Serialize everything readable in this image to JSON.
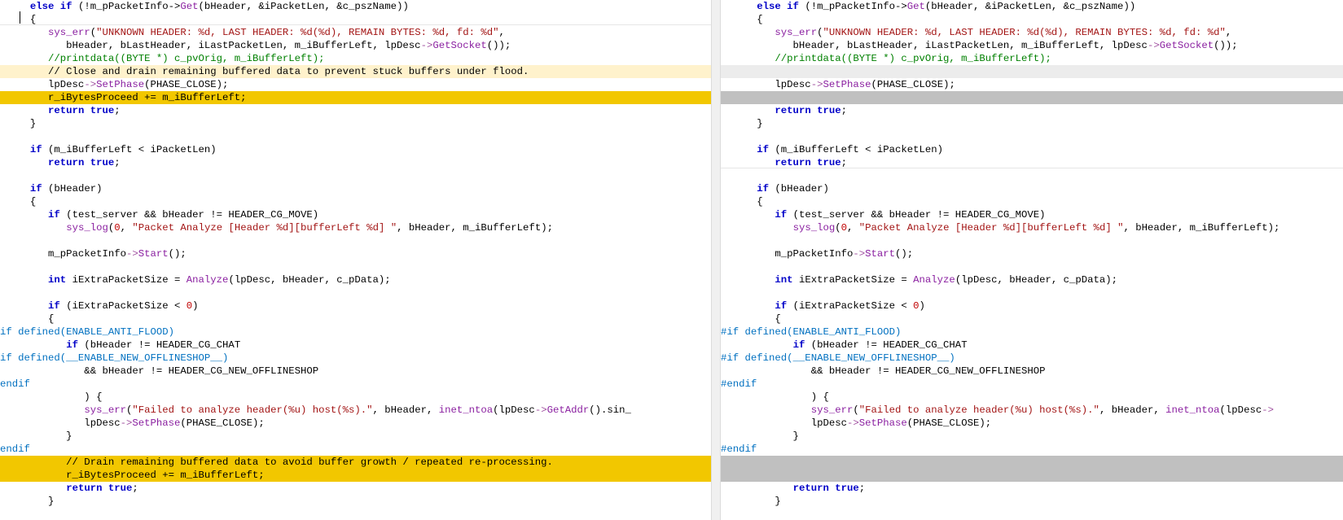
{
  "left": {
    "lines": [
      {
        "cls": "",
        "parts": [
          [
            "     ",
            ""
          ],
          [
            "else if",
            "kw"
          ],
          [
            " (!m_pPacketInfo",
            ""
          ],
          [
            "->",
            ""
          ],
          [
            "Get",
            "fn"
          ],
          [
            "(bHeader, &iPacketLen, &c_pszName))",
            ""
          ]
        ]
      },
      {
        "cls": "",
        "parts": [
          [
            "     {",
            ""
          ]
        ]
      },
      {
        "cls": "",
        "parts": [
          [
            "        ",
            ""
          ],
          [
            "sys_err",
            "fn"
          ],
          [
            "(",
            ""
          ],
          [
            "\"UNKNOWN HEADER: %d, LAST HEADER: %d(%d), REMAIN BYTES: %d, fd: %d\"",
            "str"
          ],
          [
            ",",
            ""
          ]
        ]
      },
      {
        "cls": "",
        "parts": [
          [
            "           bHeader, bLastHeader, iLastPacketLen, m_iBufferLeft, lpDesc",
            ""
          ],
          [
            "->",
            "op"
          ],
          [
            "GetSocket",
            "fn"
          ],
          [
            "());",
            ""
          ]
        ]
      },
      {
        "cls": "",
        "parts": [
          [
            "        ",
            ""
          ],
          [
            "//printdata((BYTE *) c_pvOrig, m_iBufferLeft);",
            "cm"
          ]
        ]
      },
      {
        "cls": "changed",
        "parts": [
          [
            "        // Close and drain remaining buffered data to prevent stuck buffers under flood.",
            ""
          ]
        ]
      },
      {
        "cls": "",
        "parts": [
          [
            "        lpDesc",
            ""
          ],
          [
            "->",
            "op"
          ],
          [
            "SetPhase",
            "fn"
          ],
          [
            "(PHASE_CLOSE);",
            ""
          ]
        ]
      },
      {
        "cls": "changed-strong",
        "parts": [
          [
            "        r_iBytesProceed += m_iBufferLeft;",
            ""
          ]
        ]
      },
      {
        "cls": "",
        "parts": [
          [
            "        ",
            ""
          ],
          [
            "return true",
            "kw"
          ],
          [
            ";",
            ""
          ]
        ]
      },
      {
        "cls": "",
        "parts": [
          [
            "     }",
            ""
          ]
        ]
      },
      {
        "cls": "",
        "parts": [
          [
            "",
            ""
          ]
        ]
      },
      {
        "cls": "",
        "parts": [
          [
            "     ",
            ""
          ],
          [
            "if",
            "kw"
          ],
          [
            " (m_iBufferLeft < iPacketLen)",
            ""
          ]
        ]
      },
      {
        "cls": "",
        "parts": [
          [
            "        ",
            ""
          ],
          [
            "return true",
            "kw"
          ],
          [
            ";",
            ""
          ]
        ]
      },
      {
        "cls": "",
        "parts": [
          [
            "",
            ""
          ]
        ]
      },
      {
        "cls": "",
        "parts": [
          [
            "     ",
            ""
          ],
          [
            "if",
            "kw"
          ],
          [
            " (bHeader)",
            ""
          ]
        ]
      },
      {
        "cls": "",
        "parts": [
          [
            "     {",
            ""
          ]
        ]
      },
      {
        "cls": "",
        "parts": [
          [
            "        ",
            ""
          ],
          [
            "if",
            "kw"
          ],
          [
            " (test_server && bHeader != HEADER_CG_MOVE)",
            ""
          ]
        ]
      },
      {
        "cls": "",
        "parts": [
          [
            "           ",
            ""
          ],
          [
            "sys_log",
            "fn"
          ],
          [
            "(",
            ""
          ],
          [
            "0",
            "num"
          ],
          [
            ", ",
            ""
          ],
          [
            "\"Packet Analyze [Header %d][bufferLeft %d] \"",
            "str"
          ],
          [
            ", bHeader, m_iBufferLeft);",
            ""
          ]
        ]
      },
      {
        "cls": "",
        "parts": [
          [
            "",
            ""
          ]
        ]
      },
      {
        "cls": "",
        "parts": [
          [
            "        m_pPacketInfo",
            ""
          ],
          [
            "->",
            "op"
          ],
          [
            "Start",
            "fn"
          ],
          [
            "();",
            ""
          ]
        ]
      },
      {
        "cls": "",
        "parts": [
          [
            "",
            ""
          ]
        ]
      },
      {
        "cls": "",
        "parts": [
          [
            "        ",
            ""
          ],
          [
            "int",
            "kw"
          ],
          [
            " iExtraPacketSize = ",
            ""
          ],
          [
            "Analyze",
            "fn"
          ],
          [
            "(lpDesc, bHeader, c_pData);",
            ""
          ]
        ]
      },
      {
        "cls": "",
        "parts": [
          [
            "",
            ""
          ]
        ]
      },
      {
        "cls": "",
        "parts": [
          [
            "        ",
            ""
          ],
          [
            "if",
            "kw"
          ],
          [
            " (iExtraPacketSize < ",
            ""
          ],
          [
            "0",
            "num"
          ],
          [
            ")",
            ""
          ]
        ]
      },
      {
        "cls": "",
        "parts": [
          [
            "        {",
            ""
          ]
        ]
      },
      {
        "cls": "",
        "parts": [
          [
            "if defined(ENABLE_ANTI_FLOOD)",
            "pp"
          ]
        ]
      },
      {
        "cls": "",
        "parts": [
          [
            "           ",
            ""
          ],
          [
            "if",
            "kw"
          ],
          [
            " (bHeader != HEADER_CG_CHAT",
            ""
          ]
        ]
      },
      {
        "cls": "",
        "parts": [
          [
            "if defined(__ENABLE_NEW_OFFLINESHOP__)",
            "pp"
          ]
        ]
      },
      {
        "cls": "",
        "parts": [
          [
            "              && bHeader != HEADER_CG_NEW_OFFLINESHOP",
            ""
          ]
        ]
      },
      {
        "cls": "",
        "parts": [
          [
            "endif",
            "pp"
          ]
        ]
      },
      {
        "cls": "",
        "parts": [
          [
            "              ) {",
            ""
          ]
        ]
      },
      {
        "cls": "",
        "parts": [
          [
            "              ",
            ""
          ],
          [
            "sys_err",
            "fn"
          ],
          [
            "(",
            ""
          ],
          [
            "\"Failed to analyze header(%u) host(%s).\"",
            "str"
          ],
          [
            ", bHeader, ",
            ""
          ],
          [
            "inet_ntoa",
            "fn"
          ],
          [
            "(lpDesc",
            ""
          ],
          [
            "->",
            "op"
          ],
          [
            "GetAddr",
            "fn"
          ],
          [
            "().sin_",
            ""
          ]
        ]
      },
      {
        "cls": "",
        "parts": [
          [
            "              lpDesc",
            ""
          ],
          [
            "->",
            "op"
          ],
          [
            "SetPhase",
            "fn"
          ],
          [
            "(PHASE_CLOSE);",
            ""
          ]
        ]
      },
      {
        "cls": "",
        "parts": [
          [
            "           }",
            ""
          ]
        ]
      },
      {
        "cls": "",
        "parts": [
          [
            "endif",
            "pp"
          ]
        ]
      },
      {
        "cls": "changed-strong",
        "parts": [
          [
            "           // Drain remaining buffered data to avoid buffer growth / repeated re-processing.",
            ""
          ]
        ]
      },
      {
        "cls": "changed-strong",
        "parts": [
          [
            "           r_iBytesProceed += m_iBufferLeft;",
            ""
          ]
        ]
      },
      {
        "cls": "",
        "parts": [
          [
            "           ",
            ""
          ],
          [
            "return true",
            "kw"
          ],
          [
            ";",
            ""
          ]
        ]
      },
      {
        "cls": "",
        "parts": [
          [
            "        }",
            ""
          ]
        ]
      }
    ]
  },
  "right": {
    "lines": [
      {
        "cls": "",
        "parts": [
          [
            "      ",
            ""
          ],
          [
            "else if",
            "kw"
          ],
          [
            " (!m_pPacketInfo",
            ""
          ],
          [
            "->",
            ""
          ],
          [
            "Get",
            "fn"
          ],
          [
            "(bHeader, &iPacketLen, &c_pszName))",
            ""
          ]
        ]
      },
      {
        "cls": "",
        "parts": [
          [
            "      {",
            ""
          ]
        ]
      },
      {
        "cls": "",
        "parts": [
          [
            "         ",
            ""
          ],
          [
            "sys_err",
            "fn"
          ],
          [
            "(",
            ""
          ],
          [
            "\"UNKNOWN HEADER: %d, LAST HEADER: %d(%d), REMAIN BYTES: %d, fd: %d\"",
            "str"
          ],
          [
            ",",
            ""
          ]
        ]
      },
      {
        "cls": "",
        "parts": [
          [
            "            bHeader, bLastHeader, iLastPacketLen, m_iBufferLeft, lpDesc",
            ""
          ],
          [
            "->",
            "op"
          ],
          [
            "GetSocket",
            "fn"
          ],
          [
            "());",
            ""
          ]
        ]
      },
      {
        "cls": "",
        "parts": [
          [
            "         ",
            ""
          ],
          [
            "//printdata((BYTE *) c_pvOrig, m_iBufferLeft);",
            "cm"
          ]
        ]
      },
      {
        "cls": "gap",
        "parts": [
          [
            "",
            ""
          ]
        ]
      },
      {
        "cls": "",
        "parts": [
          [
            "         lpDesc",
            ""
          ],
          [
            "->",
            "op"
          ],
          [
            "SetPhase",
            "fn"
          ],
          [
            "(PHASE_CLOSE);",
            ""
          ]
        ]
      },
      {
        "cls": "gap-strong",
        "parts": [
          [
            "",
            ""
          ]
        ]
      },
      {
        "cls": "",
        "parts": [
          [
            "         ",
            ""
          ],
          [
            "return true",
            "kw"
          ],
          [
            ";",
            ""
          ]
        ]
      },
      {
        "cls": "",
        "parts": [
          [
            "      }",
            ""
          ]
        ]
      },
      {
        "cls": "",
        "parts": [
          [
            "",
            ""
          ]
        ]
      },
      {
        "cls": "",
        "parts": [
          [
            "      ",
            ""
          ],
          [
            "if",
            "kw"
          ],
          [
            " (m_iBufferLeft < iPacketLen)",
            ""
          ]
        ]
      },
      {
        "cls": "",
        "parts": [
          [
            "         ",
            ""
          ],
          [
            "return true",
            "kw"
          ],
          [
            ";",
            ""
          ]
        ]
      },
      {
        "cls": "",
        "parts": [
          [
            "",
            ""
          ]
        ]
      },
      {
        "cls": "",
        "parts": [
          [
            "      ",
            ""
          ],
          [
            "if",
            "kw"
          ],
          [
            " (bHeader)",
            ""
          ]
        ]
      },
      {
        "cls": "",
        "parts": [
          [
            "      {",
            ""
          ]
        ]
      },
      {
        "cls": "",
        "parts": [
          [
            "         ",
            ""
          ],
          [
            "if",
            "kw"
          ],
          [
            " (test_server && bHeader != HEADER_CG_MOVE)",
            ""
          ]
        ]
      },
      {
        "cls": "",
        "parts": [
          [
            "            ",
            ""
          ],
          [
            "sys_log",
            "fn"
          ],
          [
            "(",
            ""
          ],
          [
            "0",
            "num"
          ],
          [
            ", ",
            ""
          ],
          [
            "\"Packet Analyze [Header %d][bufferLeft %d] \"",
            "str"
          ],
          [
            ", bHeader, m_iBufferLeft);",
            ""
          ]
        ]
      },
      {
        "cls": "",
        "parts": [
          [
            "",
            ""
          ]
        ]
      },
      {
        "cls": "",
        "parts": [
          [
            "         m_pPacketInfo",
            ""
          ],
          [
            "->",
            "op"
          ],
          [
            "Start",
            "fn"
          ],
          [
            "();",
            ""
          ]
        ]
      },
      {
        "cls": "",
        "parts": [
          [
            "",
            ""
          ]
        ]
      },
      {
        "cls": "",
        "parts": [
          [
            "         ",
            ""
          ],
          [
            "int",
            "kw"
          ],
          [
            " iExtraPacketSize = ",
            ""
          ],
          [
            "Analyze",
            "fn"
          ],
          [
            "(lpDesc, bHeader, c_pData);",
            ""
          ]
        ]
      },
      {
        "cls": "",
        "parts": [
          [
            "",
            ""
          ]
        ]
      },
      {
        "cls": "",
        "parts": [
          [
            "         ",
            ""
          ],
          [
            "if",
            "kw"
          ],
          [
            " (iExtraPacketSize < ",
            ""
          ],
          [
            "0",
            "num"
          ],
          [
            ")",
            ""
          ]
        ]
      },
      {
        "cls": "",
        "parts": [
          [
            "         {",
            ""
          ]
        ]
      },
      {
        "cls": "",
        "parts": [
          [
            "#if defined(ENABLE_ANTI_FLOOD)",
            "pp"
          ]
        ]
      },
      {
        "cls": "",
        "parts": [
          [
            "            ",
            ""
          ],
          [
            "if",
            "kw"
          ],
          [
            " (bHeader != HEADER_CG_CHAT",
            ""
          ]
        ]
      },
      {
        "cls": "",
        "parts": [
          [
            "#if defined(__ENABLE_NEW_OFFLINESHOP__)",
            "pp"
          ]
        ]
      },
      {
        "cls": "",
        "parts": [
          [
            "               && bHeader != HEADER_CG_NEW_OFFLINESHOP",
            ""
          ]
        ]
      },
      {
        "cls": "",
        "parts": [
          [
            "#endif",
            "pp"
          ]
        ]
      },
      {
        "cls": "",
        "parts": [
          [
            "               ) {",
            ""
          ]
        ]
      },
      {
        "cls": "",
        "parts": [
          [
            "               ",
            ""
          ],
          [
            "sys_err",
            "fn"
          ],
          [
            "(",
            ""
          ],
          [
            "\"Failed to analyze header(%u) host(%s).\"",
            "str"
          ],
          [
            ", bHeader, ",
            ""
          ],
          [
            "inet_ntoa",
            "fn"
          ],
          [
            "(lpDesc",
            ""
          ],
          [
            "->",
            "op"
          ],
          [
            "",
            ""
          ]
        ]
      },
      {
        "cls": "",
        "parts": [
          [
            "               lpDesc",
            ""
          ],
          [
            "->",
            "op"
          ],
          [
            "SetPhase",
            "fn"
          ],
          [
            "(PHASE_CLOSE);",
            ""
          ]
        ]
      },
      {
        "cls": "",
        "parts": [
          [
            "            }",
            ""
          ]
        ]
      },
      {
        "cls": "",
        "parts": [
          [
            "#endif",
            "pp"
          ]
        ]
      },
      {
        "cls": "gap-strong",
        "parts": [
          [
            "",
            ""
          ]
        ]
      },
      {
        "cls": "gap-strong",
        "parts": [
          [
            "",
            ""
          ]
        ]
      },
      {
        "cls": "",
        "parts": [
          [
            "            ",
            ""
          ],
          [
            "return true",
            "kw"
          ],
          [
            ";",
            ""
          ]
        ]
      },
      {
        "cls": "",
        "parts": [
          [
            "         }",
            ""
          ]
        ]
      }
    ]
  }
}
